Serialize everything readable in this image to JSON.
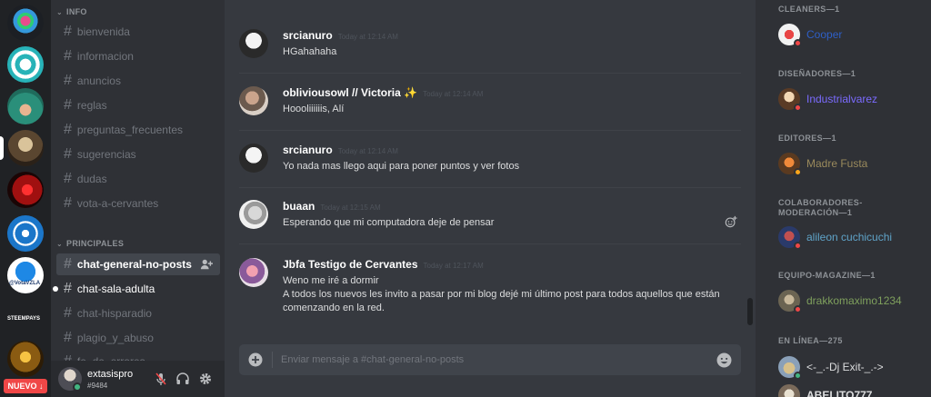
{
  "servers": {
    "new_badge": "NUEVO ↓",
    "labels": [
      "STEEMPAYS",
      "@VotaVZLA"
    ]
  },
  "channels": {
    "categories": {
      "info": "INFO",
      "principales": "PRINCIPALES"
    },
    "info_items": [
      "bienvenida",
      "informacion",
      "anuncios",
      "reglas",
      "preguntas_frecuentes",
      "sugerencias",
      "dudas",
      "vota-a-cervantes"
    ],
    "principales_items": [
      "chat-general-no-posts",
      "chat-sala-adulta",
      "chat-hisparadio",
      "plagio_y_abuso",
      "fe_de_errores"
    ]
  },
  "user": {
    "name": "extasispro",
    "tag": "#9484"
  },
  "messages": [
    {
      "author": "srcianuro",
      "time": "Today at 12:14 AM",
      "lines": [
        "HGahahaha"
      ]
    },
    {
      "author": "obliviousowl // Victoria",
      "emoji": "✨",
      "time": "Today at 12:14 AM",
      "lines": [
        "Hoooliiiiiis, Alí"
      ]
    },
    {
      "author": "srcianuro",
      "time": "Today at 12:14 AM",
      "lines": [
        "Yo nada mas llego aqui para poner puntos y ver fotos"
      ]
    },
    {
      "author": "buaan",
      "time": "Today at 12:15 AM",
      "lines": [
        "Esperando que mi computadora deje de pensar"
      ]
    },
    {
      "author": "Jbfa Testigo de Cervantes",
      "time": "Today at 12:17 AM",
      "lines": [
        "Weno me iré a dormir",
        "A todos los nuevos les invito a pasar por mi blog dejé mi último post para todos aquellos que están comenzando en la red."
      ]
    }
  ],
  "composer": {
    "placeholder": "Enviar mensaje a #chat-general-no-posts"
  },
  "members": {
    "roles": [
      {
        "label": "CLEANERS—1",
        "members": [
          {
            "name": "Cooper",
            "color": "#2e5fc7",
            "status": "dnd"
          }
        ]
      },
      {
        "label": "DISEÑADORES—1",
        "members": [
          {
            "name": "Industrialvarez",
            "color": "#7b6bff",
            "status": "dnd"
          }
        ]
      },
      {
        "label": "EDITORES—1",
        "members": [
          {
            "name": "Madre Fusta",
            "color": "#9a8a5c",
            "status": "idle"
          }
        ]
      },
      {
        "label": "COLABORADORES-\nMODERACIÓN—1",
        "members": [
          {
            "name": "alileon cuchicuchi",
            "color": "#5fa3c8",
            "status": "dnd"
          }
        ]
      },
      {
        "label": "EQUIPO-MAGAZINE—1",
        "members": [
          {
            "name": "drakkomaximo1234",
            "color": "#7fa05d",
            "status": "dnd"
          }
        ]
      },
      {
        "label": "EN LÍNEA—275",
        "members": [
          {
            "name": "<-_.-Dj Exit-_.->",
            "color": "#dcddde",
            "status": "online"
          },
          {
            "name": "ABELITO777",
            "color": "#dcddde",
            "status": "dnd"
          }
        ]
      }
    ]
  },
  "colors": {
    "online": "#43b581",
    "idle": "#faa61a",
    "dnd": "#f04747"
  }
}
